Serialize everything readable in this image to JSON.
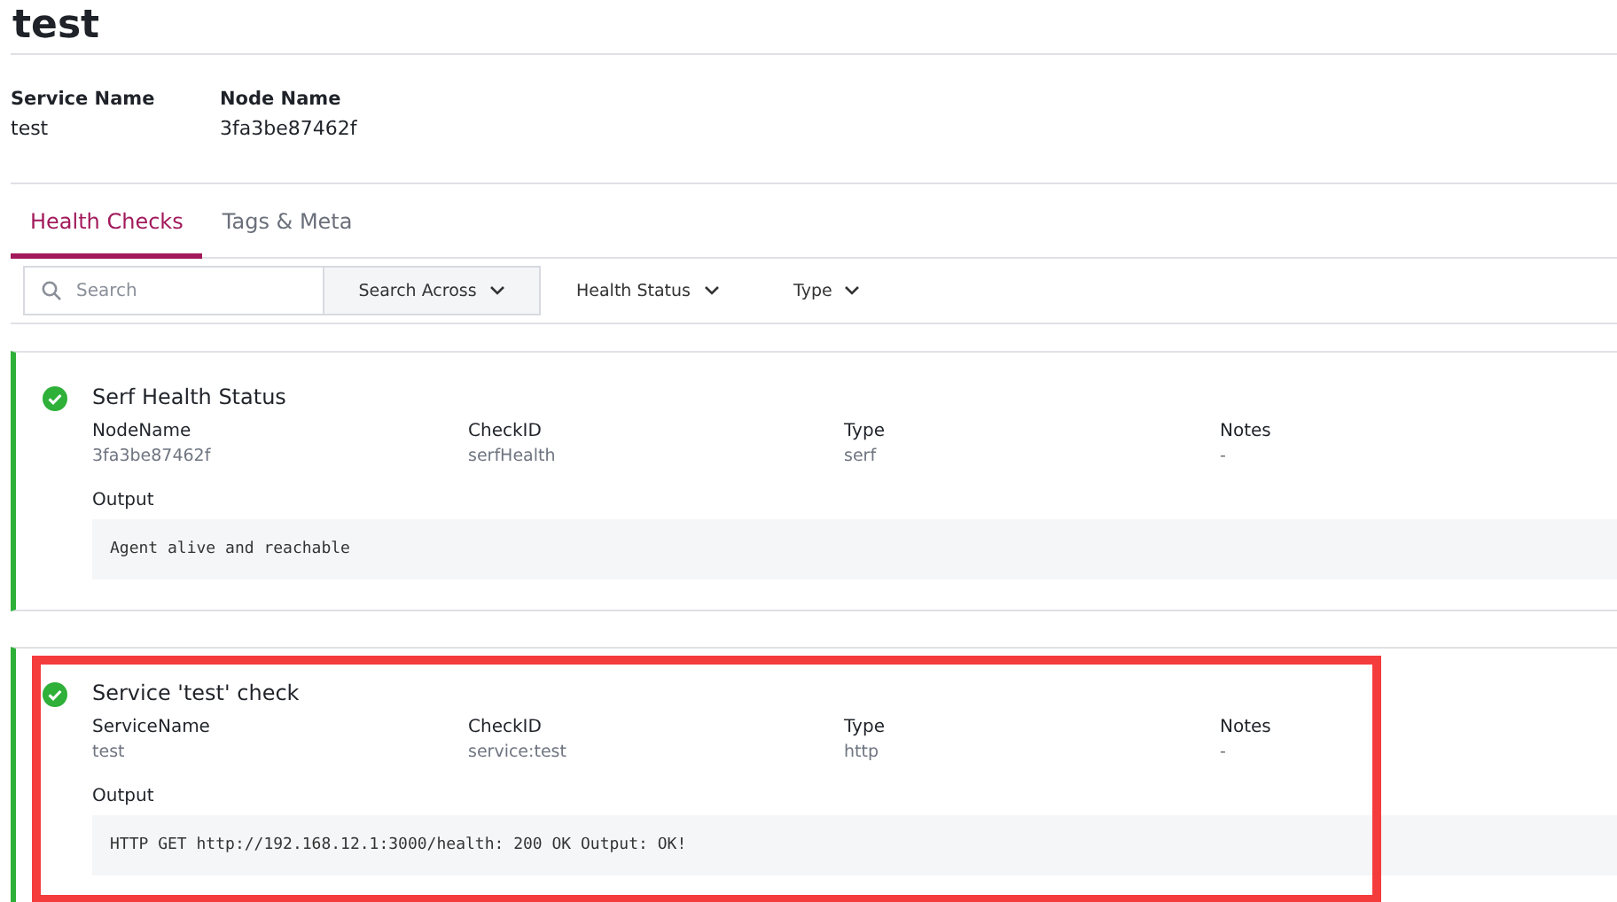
{
  "title": "test",
  "meta": [
    {
      "label": "Service Name",
      "value": "test"
    },
    {
      "label": "Node Name",
      "value": "3fa3be87462f"
    }
  ],
  "tabs": [
    {
      "label": "Health Checks",
      "selected": true
    },
    {
      "label": "Tags & Meta",
      "selected": false
    }
  ],
  "filters": {
    "search": {
      "placeholder": "Search"
    },
    "search_across": "Search Across",
    "dropdowns": [
      "Health Status",
      "Type"
    ]
  },
  "checks": [
    {
      "name": "Serf Health Status",
      "color": "#2eb039",
      "highlighted": false,
      "fields": [
        {
          "label": "NodeName",
          "value": "3fa3be87462f"
        },
        {
          "label": "CheckID",
          "value": "serfHealth"
        },
        {
          "label": "Type",
          "value": "serf"
        },
        {
          "label": "Notes",
          "value": "-"
        }
      ],
      "output_label": "Output",
      "output": "Agent alive and reachable"
    },
    {
      "name": "Service 'test' check",
      "color": "#2eb039",
      "highlighted": true,
      "fields": [
        {
          "label": "ServiceName",
          "value": "test"
        },
        {
          "label": "CheckID",
          "value": "service:test"
        },
        {
          "label": "Type",
          "value": "http"
        },
        {
          "label": "Notes",
          "value": "-"
        }
      ],
      "output_label": "Output",
      "output": "HTTP GET http://192.168.12.1:3000/health: 200 OK Output: OK!"
    }
  ]
}
